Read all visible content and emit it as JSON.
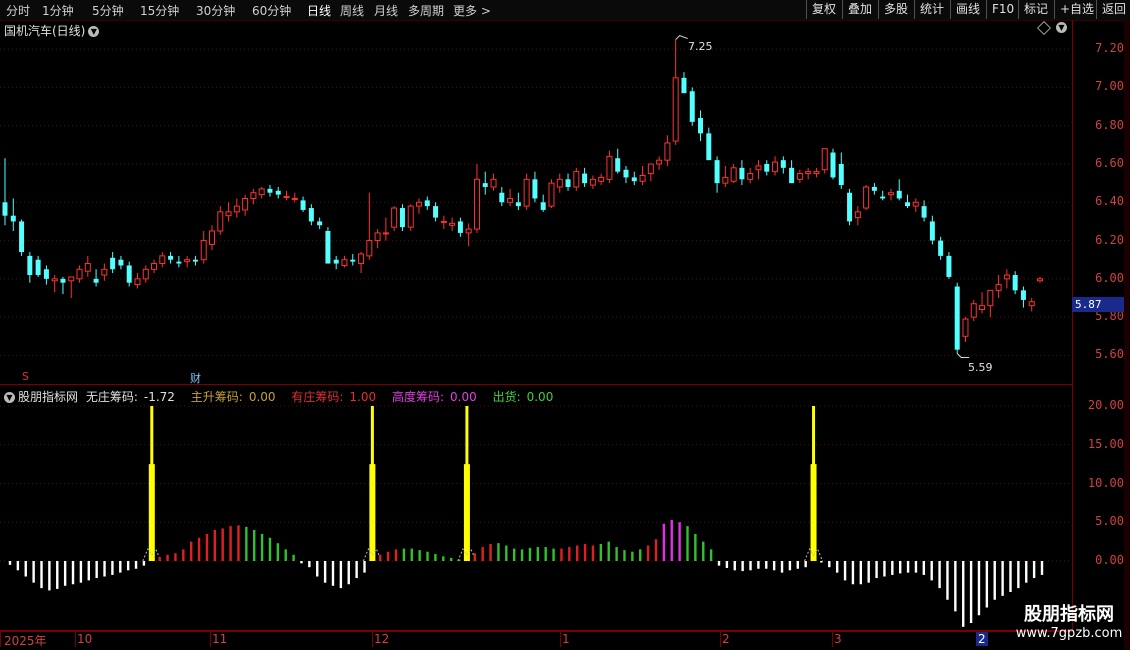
{
  "toolbar": {
    "periods": [
      "分时",
      "1分钟",
      "5分钟",
      "15分钟",
      "30分钟",
      "60分钟",
      "日线",
      "周线",
      "月线",
      "多周期",
      "更多 >"
    ],
    "active_period": "日线",
    "buttons": [
      "复权",
      "叠加",
      "多股",
      "统计",
      "画线",
      "F10",
      "标记",
      "+自选",
      "返回"
    ]
  },
  "chart_title": "国机汽车(日线)",
  "main_chart": {
    "type": "candlestick",
    "y_ticks": [
      "7.20",
      "7.00",
      "6.80",
      "6.60",
      "6.40",
      "6.20",
      "6.00",
      "5.80",
      "5.60"
    ],
    "ylim": [
      5.55,
      7.3
    ],
    "current_price": "5.87",
    "high_label": "7.25",
    "low_label": "5.59",
    "flags": {
      "s_flag": "S",
      "cai_flag": "财"
    },
    "candles": [
      [
        6.4,
        6.63,
        6.28,
        6.33
      ],
      [
        6.33,
        6.42,
        6.25,
        6.3
      ],
      [
        6.3,
        6.31,
        6.12,
        6.14
      ],
      [
        6.12,
        6.14,
        5.98,
        6.02
      ],
      [
        6.1,
        6.12,
        6.01,
        6.02
      ],
      [
        6.05,
        6.07,
        5.97,
        6.0
      ],
      [
        5.99,
        6.02,
        5.93,
        6.0
      ],
      [
        6.0,
        6.01,
        5.92,
        5.98
      ],
      [
        5.99,
        6.01,
        5.9,
        6.01
      ],
      [
        6.0,
        6.07,
        5.98,
        6.05
      ],
      [
        6.04,
        6.12,
        6.01,
        6.08
      ],
      [
        6.0,
        6.05,
        5.96,
        5.98
      ],
      [
        6.02,
        6.08,
        5.99,
        6.05
      ],
      [
        6.11,
        6.14,
        6.03,
        6.05
      ],
      [
        6.1,
        6.12,
        6.05,
        6.07
      ],
      [
        6.07,
        6.09,
        5.96,
        5.98
      ],
      [
        5.97,
        6.03,
        5.95,
        6.0
      ],
      [
        6.0,
        6.07,
        5.98,
        6.05
      ],
      [
        6.05,
        6.1,
        6.03,
        6.08
      ],
      [
        6.08,
        6.14,
        6.06,
        6.12
      ],
      [
        6.12,
        6.14,
        6.08,
        6.1
      ],
      [
        6.09,
        6.12,
        6.06,
        6.08
      ],
      [
        6.09,
        6.12,
        6.06,
        6.1
      ],
      [
        6.1,
        6.12,
        6.07,
        6.09
      ],
      [
        6.1,
        6.25,
        6.08,
        6.2
      ],
      [
        6.18,
        6.28,
        6.15,
        6.25
      ],
      [
        6.25,
        6.38,
        6.23,
        6.35
      ],
      [
        6.33,
        6.4,
        6.3,
        6.35
      ],
      [
        6.35,
        6.42,
        6.32,
        6.38
      ],
      [
        6.36,
        6.44,
        6.33,
        6.42
      ],
      [
        6.42,
        6.47,
        6.39,
        6.45
      ],
      [
        6.44,
        6.48,
        6.42,
        6.47
      ],
      [
        6.47,
        6.49,
        6.43,
        6.45
      ],
      [
        6.46,
        6.48,
        6.42,
        6.44
      ],
      [
        6.43,
        6.46,
        6.41,
        6.43
      ],
      [
        6.42,
        6.45,
        6.4,
        6.42
      ],
      [
        6.41,
        6.43,
        6.35,
        6.36
      ],
      [
        6.37,
        6.39,
        6.28,
        6.3
      ],
      [
        6.3,
        6.32,
        6.26,
        6.28
      ],
      [
        6.25,
        6.27,
        6.08,
        6.08
      ],
      [
        6.1,
        6.12,
        6.05,
        6.08
      ],
      [
        6.07,
        6.12,
        6.06,
        6.1
      ],
      [
        6.1,
        6.13,
        6.07,
        6.09
      ],
      [
        6.08,
        6.14,
        6.03,
        6.13
      ],
      [
        6.12,
        6.45,
        6.1,
        6.2
      ],
      [
        6.2,
        6.26,
        6.16,
        6.24
      ],
      [
        6.24,
        6.32,
        6.2,
        6.24
      ],
      [
        6.27,
        6.38,
        6.25,
        6.37
      ],
      [
        6.37,
        6.39,
        6.25,
        6.27
      ],
      [
        6.27,
        6.39,
        6.25,
        6.38
      ],
      [
        6.38,
        6.42,
        6.34,
        6.4
      ],
      [
        6.41,
        6.43,
        6.36,
        6.38
      ],
      [
        6.38,
        6.4,
        6.3,
        6.32
      ],
      [
        6.3,
        6.33,
        6.26,
        6.3
      ],
      [
        6.28,
        6.32,
        6.25,
        6.29
      ],
      [
        6.3,
        6.32,
        6.22,
        6.24
      ],
      [
        6.24,
        6.29,
        6.17,
        6.26
      ],
      [
        6.26,
        6.6,
        6.24,
        6.52
      ],
      [
        6.5,
        6.56,
        6.44,
        6.48
      ],
      [
        6.48,
        6.55,
        6.46,
        6.52
      ],
      [
        6.45,
        6.48,
        6.38,
        6.4
      ],
      [
        6.4,
        6.47,
        6.38,
        6.42
      ],
      [
        6.4,
        6.45,
        6.36,
        6.38
      ],
      [
        6.38,
        6.55,
        6.36,
        6.52
      ],
      [
        6.52,
        6.56,
        6.4,
        6.42
      ],
      [
        6.4,
        6.44,
        6.35,
        6.36
      ],
      [
        6.38,
        6.52,
        6.37,
        6.5
      ],
      [
        6.48,
        6.55,
        6.45,
        6.52
      ],
      [
        6.52,
        6.55,
        6.46,
        6.48
      ],
      [
        6.48,
        6.58,
        6.46,
        6.56
      ],
      [
        6.55,
        6.58,
        6.48,
        6.5
      ],
      [
        6.49,
        6.54,
        6.47,
        6.52
      ],
      [
        6.51,
        6.55,
        6.49,
        6.53
      ],
      [
        6.52,
        6.67,
        6.5,
        6.64
      ],
      [
        6.63,
        6.68,
        6.55,
        6.56
      ],
      [
        6.57,
        6.59,
        6.5,
        6.53
      ],
      [
        6.53,
        6.56,
        6.49,
        6.51
      ],
      [
        6.51,
        6.59,
        6.49,
        6.54
      ],
      [
        6.55,
        6.6,
        6.51,
        6.6
      ],
      [
        6.6,
        6.64,
        6.57,
        6.62
      ],
      [
        6.62,
        6.75,
        6.59,
        6.71
      ],
      [
        6.72,
        7.25,
        6.7,
        7.05
      ],
      [
        7.05,
        7.08,
        6.98,
        6.97
      ],
      [
        6.98,
        7.0,
        6.8,
        6.82
      ],
      [
        6.84,
        6.88,
        6.72,
        6.76
      ],
      [
        6.76,
        6.79,
        6.63,
        6.62
      ],
      [
        6.62,
        6.64,
        6.45,
        6.5
      ],
      [
        6.5,
        6.59,
        6.48,
        6.53
      ],
      [
        6.51,
        6.6,
        6.5,
        6.58
      ],
      [
        6.58,
        6.62,
        6.49,
        6.52
      ],
      [
        6.52,
        6.58,
        6.5,
        6.55
      ],
      [
        6.57,
        6.62,
        6.52,
        6.59
      ],
      [
        6.6,
        6.62,
        6.54,
        6.56
      ],
      [
        6.56,
        6.64,
        6.54,
        6.61
      ],
      [
        6.62,
        6.64,
        6.55,
        6.58
      ],
      [
        6.58,
        6.62,
        6.5,
        6.5
      ],
      [
        6.52,
        6.57,
        6.5,
        6.55
      ],
      [
        6.55,
        6.58,
        6.52,
        6.56
      ],
      [
        6.55,
        6.58,
        6.53,
        6.56
      ],
      [
        6.57,
        6.68,
        6.55,
        6.68
      ],
      [
        6.66,
        6.68,
        6.52,
        6.53
      ],
      [
        6.6,
        6.66,
        6.47,
        6.49
      ],
      [
        6.45,
        6.47,
        6.28,
        6.3
      ],
      [
        6.32,
        6.38,
        6.28,
        6.35
      ],
      [
        6.37,
        6.49,
        6.36,
        6.48
      ],
      [
        6.48,
        6.5,
        6.44,
        6.46
      ],
      [
        6.43,
        6.46,
        6.41,
        6.42
      ],
      [
        6.44,
        6.47,
        6.41,
        6.45
      ],
      [
        6.46,
        6.52,
        6.41,
        6.42
      ],
      [
        6.4,
        6.44,
        6.37,
        6.38
      ],
      [
        6.38,
        6.42,
        6.35,
        6.4
      ],
      [
        6.38,
        6.41,
        6.3,
        6.32
      ],
      [
        6.3,
        6.33,
        6.18,
        6.2
      ],
      [
        6.2,
        6.22,
        6.1,
        6.12
      ],
      [
        6.12,
        6.14,
        6.0,
        6.01
      ],
      [
        5.96,
        5.98,
        5.61,
        5.63
      ],
      [
        5.7,
        5.8,
        5.67,
        5.79
      ],
      [
        5.8,
        5.89,
        5.78,
        5.87
      ],
      [
        5.84,
        5.93,
        5.82,
        5.86
      ],
      [
        5.86,
        5.93,
        5.8,
        5.94
      ],
      [
        5.94,
        6.02,
        5.9,
        5.97
      ],
      [
        6.0,
        6.05,
        5.95,
        6.02
      ],
      [
        6.02,
        6.04,
        5.92,
        5.94
      ],
      [
        5.94,
        5.96,
        5.85,
        5.89
      ],
      [
        5.86,
        5.9,
        5.83,
        5.88
      ],
      [
        5.99,
        6.01,
        5.98,
        6.0
      ]
    ]
  },
  "indicator": {
    "name": "股朋指标网",
    "legend": [
      {
        "label": "无庄筹码:",
        "value": "-1.72",
        "color": "#e0e0e0"
      },
      {
        "label": "主升筹码:",
        "value": "0.00",
        "color": "#c8a030"
      },
      {
        "label": "有庄筹码:",
        "value": "1.00",
        "color": "#e03030"
      },
      {
        "label": "高度筹码:",
        "value": "0.00",
        "color": "#e040e0"
      },
      {
        "label": "出货:",
        "value": "0.00",
        "color": "#40d040"
      }
    ],
    "y_ticks": [
      "20.00",
      "15.00",
      "10.00",
      "5.00",
      "0.00"
    ],
    "ylim": [
      -8.6,
      20.8
    ],
    "colors": {
      "white": "#ffffff",
      "yellow": "#ffff00",
      "red": "#e02020",
      "green": "#30c030",
      "magenta": "#e030e0"
    },
    "bars": [
      [
        "w",
        -0.5
      ],
      [
        "w",
        -1.2
      ],
      [
        "w",
        -2.0
      ],
      [
        "w",
        -2.8
      ],
      [
        "w",
        -3.5
      ],
      [
        "w",
        -3.8
      ],
      [
        "w",
        -3.6
      ],
      [
        "w",
        -3.2
      ],
      [
        "w",
        -3.0
      ],
      [
        "w",
        -2.8
      ],
      [
        "w",
        -2.5
      ],
      [
        "w",
        -2.2
      ],
      [
        "w",
        -2.0
      ],
      [
        "w",
        -1.8
      ],
      [
        "w",
        -1.5
      ],
      [
        "w",
        -1.2
      ],
      [
        "w",
        -1.0
      ],
      [
        "w",
        -0.6
      ],
      [
        "y",
        20.0
      ],
      [
        "r",
        0.5
      ],
      [
        "r",
        0.8
      ],
      [
        "r",
        1.0
      ],
      [
        "r",
        1.5
      ],
      [
        "r",
        2.5
      ],
      [
        "r",
        3.0
      ],
      [
        "r",
        3.5
      ],
      [
        "r",
        4.0
      ],
      [
        "r",
        4.2
      ],
      [
        "r",
        4.5
      ],
      [
        "r",
        4.6
      ],
      [
        "g",
        4.4
      ],
      [
        "g",
        4.0
      ],
      [
        "g",
        3.5
      ],
      [
        "g",
        3.0
      ],
      [
        "g",
        2.3
      ],
      [
        "g",
        1.5
      ],
      [
        "g",
        0.8
      ],
      [
        "w",
        -0.3
      ],
      [
        "w",
        -0.8
      ],
      [
        "w",
        -2.0
      ],
      [
        "w",
        -2.8
      ],
      [
        "w",
        -3.2
      ],
      [
        "w",
        -3.5
      ],
      [
        "w",
        -3.0
      ],
      [
        "w",
        -2.2
      ],
      [
        "w",
        -1.5
      ],
      [
        "y",
        20.0
      ],
      [
        "r",
        0.8
      ],
      [
        "r",
        1.2
      ],
      [
        "r",
        1.5
      ],
      [
        "g",
        1.6
      ],
      [
        "g",
        1.6
      ],
      [
        "g",
        1.4
      ],
      [
        "g",
        1.2
      ],
      [
        "g",
        0.9
      ],
      [
        "g",
        0.6
      ],
      [
        "g",
        0.4
      ],
      [
        "g",
        0.2
      ],
      [
        "y",
        20.0
      ],
      [
        "r",
        1.0
      ],
      [
        "r",
        1.8
      ],
      [
        "r",
        2.2
      ],
      [
        "g",
        2.3
      ],
      [
        "g",
        2.0
      ],
      [
        "g",
        1.6
      ],
      [
        "g",
        1.5
      ],
      [
        "g",
        1.7
      ],
      [
        "g",
        1.8
      ],
      [
        "g",
        1.8
      ],
      [
        "g",
        1.6
      ],
      [
        "r",
        1.6
      ],
      [
        "r",
        1.8
      ],
      [
        "r",
        2.0
      ],
      [
        "r",
        2.2
      ],
      [
        "r",
        2.0
      ],
      [
        "g",
        2.2
      ],
      [
        "g",
        2.5
      ],
      [
        "g",
        1.8
      ],
      [
        "g",
        1.4
      ],
      [
        "g",
        1.2
      ],
      [
        "g",
        1.5
      ],
      [
        "r",
        2.0
      ],
      [
        "r",
        2.8
      ],
      [
        "m",
        4.8
      ],
      [
        "m",
        5.3
      ],
      [
        "m",
        5.0
      ],
      [
        "g",
        4.5
      ],
      [
        "g",
        3.5
      ],
      [
        "g",
        2.5
      ],
      [
        "g",
        1.5
      ],
      [
        "w",
        -0.6
      ],
      [
        "w",
        -0.9
      ],
      [
        "w",
        -1.2
      ],
      [
        "w",
        -1.3
      ],
      [
        "w",
        -1.2
      ],
      [
        "w",
        -1.0
      ],
      [
        "w",
        -1.0
      ],
      [
        "w",
        -1.2
      ],
      [
        "w",
        -1.5
      ],
      [
        "w",
        -1.2
      ],
      [
        "w",
        -1.0
      ],
      [
        "w",
        -0.8
      ],
      [
        "y",
        20.0
      ],
      [
        "w",
        -0.2
      ],
      [
        "w",
        -0.8
      ],
      [
        "w",
        -1.5
      ],
      [
        "w",
        -2.5
      ],
      [
        "w",
        -3.0
      ],
      [
        "w",
        -3.0
      ],
      [
        "w",
        -2.8
      ],
      [
        "w",
        -2.2
      ],
      [
        "w",
        -2.0
      ],
      [
        "w",
        -1.8
      ],
      [
        "w",
        -1.6
      ],
      [
        "w",
        -1.5
      ],
      [
        "w",
        -1.5
      ],
      [
        "w",
        -1.8
      ],
      [
        "w",
        -2.5
      ],
      [
        "w",
        -3.5
      ],
      [
        "w",
        -5.0
      ],
      [
        "w",
        -6.5
      ],
      [
        "w",
        -8.5
      ],
      [
        "w",
        -8.0
      ],
      [
        "w",
        -7.0
      ],
      [
        "w",
        -6.0
      ],
      [
        "w",
        -5.0
      ],
      [
        "w",
        -4.5
      ],
      [
        "w",
        -4.0
      ],
      [
        "w",
        -3.5
      ],
      [
        "w",
        -2.8
      ],
      [
        "w",
        -2.2
      ],
      [
        "w",
        -1.8
      ]
    ]
  },
  "date_axis": [
    {
      "label": "2025年"
    },
    {
      "label": "10"
    },
    {
      "label": "11"
    },
    {
      "label": "12"
    },
    {
      "label": "1"
    },
    {
      "label": "2"
    },
    {
      "label": "3"
    },
    {
      "label": "2"
    }
  ],
  "watermark": {
    "line1": "股朋指标网",
    "line2": "www.7gpzb.com"
  }
}
